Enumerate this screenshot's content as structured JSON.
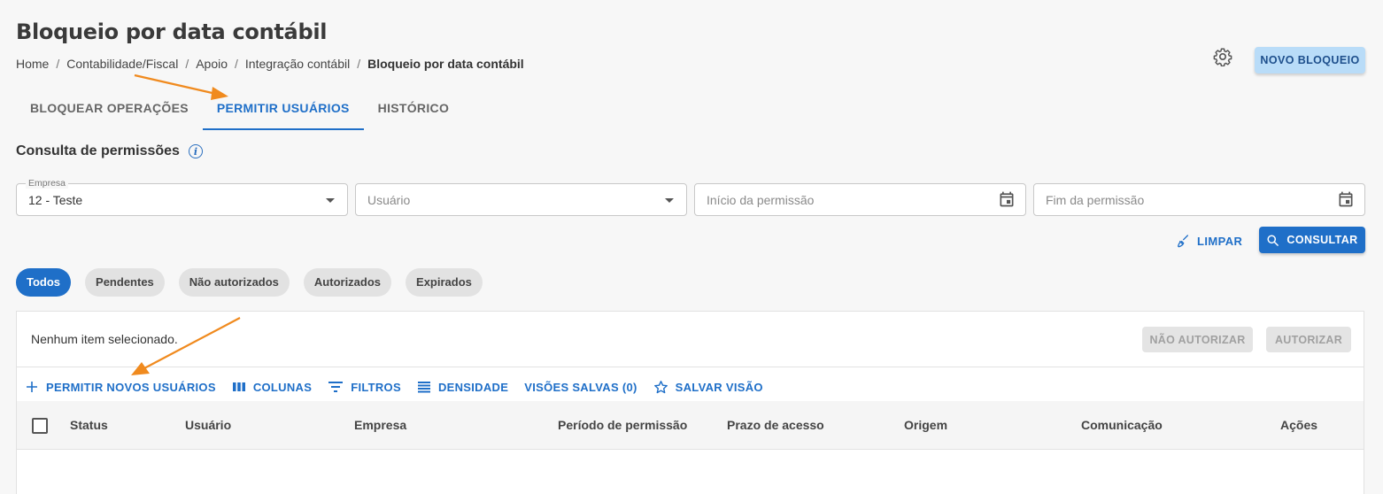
{
  "page": {
    "title": "Bloqueio por data contábil",
    "breadcrumb": [
      "Home",
      "Contabilidade/Fiscal",
      "Apoio",
      "Integração contábil",
      "Bloqueio por data contábil"
    ],
    "breadcrumb_sep": "/",
    "novo_bloqueio_label": "NOVO BLOQUEIO"
  },
  "tabs": [
    "BLOQUEAR OPERAÇÕES",
    "PERMITIR USUÁRIOS",
    "HISTÓRICO"
  ],
  "section": {
    "title": "Consulta de permissões",
    "info_icon": "i"
  },
  "filters": {
    "empresa": {
      "label": "Empresa",
      "value": "12 - Teste"
    },
    "usuario": {
      "placeholder": "Usuário"
    },
    "inicio": {
      "placeholder": "Início da permissão"
    },
    "fim": {
      "placeholder": "Fim da permissão"
    },
    "limpar_label": "LIMPAR",
    "consultar_label": "CONSULTAR"
  },
  "chips": [
    "Todos",
    "Pendentes",
    "Não autorizados",
    "Autorizados",
    "Expirados"
  ],
  "selection": {
    "text": "Nenhum item selecionado.",
    "nao_autorizar_label": "NÃO AUTORIZAR",
    "autorizar_label": "AUTORIZAR"
  },
  "toolbar": {
    "permitir_label": "PERMITIR NOVOS USUÁRIOS",
    "colunas_label": "COLUNAS",
    "filtros_label": "FILTROS",
    "densidade_label": "DENSIDADE",
    "visoes_label": "VISÕES SALVAS (0)",
    "salvar_label": "SALVAR VISÃO"
  },
  "table": {
    "columns": [
      "Status",
      "Usuário",
      "Empresa",
      "Período de permissão",
      "Prazo de acesso",
      "Origem",
      "Comunicação",
      "Ações"
    ]
  },
  "colors": {
    "accent": "#1f6fc8",
    "annotation": "#f08a1e"
  }
}
